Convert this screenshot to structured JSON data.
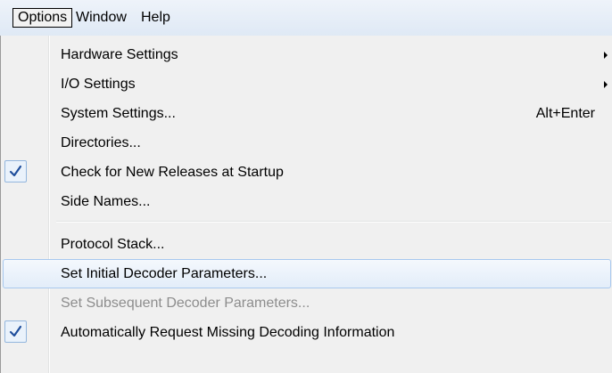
{
  "menubar": {
    "items": [
      {
        "label": "Options"
      },
      {
        "label": "Window"
      },
      {
        "label": "Help"
      }
    ]
  },
  "options_menu": {
    "items": [
      {
        "label": "Hardware Settings",
        "submenu": true
      },
      {
        "label": "I/O Settings",
        "submenu": true
      },
      {
        "label": "System Settings...",
        "shortcut": "Alt+Enter"
      },
      {
        "label": "Directories..."
      },
      {
        "label": "Check for New Releases at Startup",
        "checked": true
      },
      {
        "label": "Side Names..."
      },
      {
        "label": "Protocol Stack..."
      },
      {
        "label": "Set Initial Decoder Parameters...",
        "highlighted": true
      },
      {
        "label": "Set Subsequent Decoder Parameters...",
        "disabled": true
      },
      {
        "label": "Automatically Request Missing Decoding Information",
        "checked": true
      }
    ]
  },
  "colors": {
    "menubar_bg": "#dfe9f5",
    "menu_bg": "#f0f0f0",
    "hover_border": "#a8c8ee",
    "check_color": "#1f4e9c",
    "disabled_text": "#8d8d8d"
  }
}
